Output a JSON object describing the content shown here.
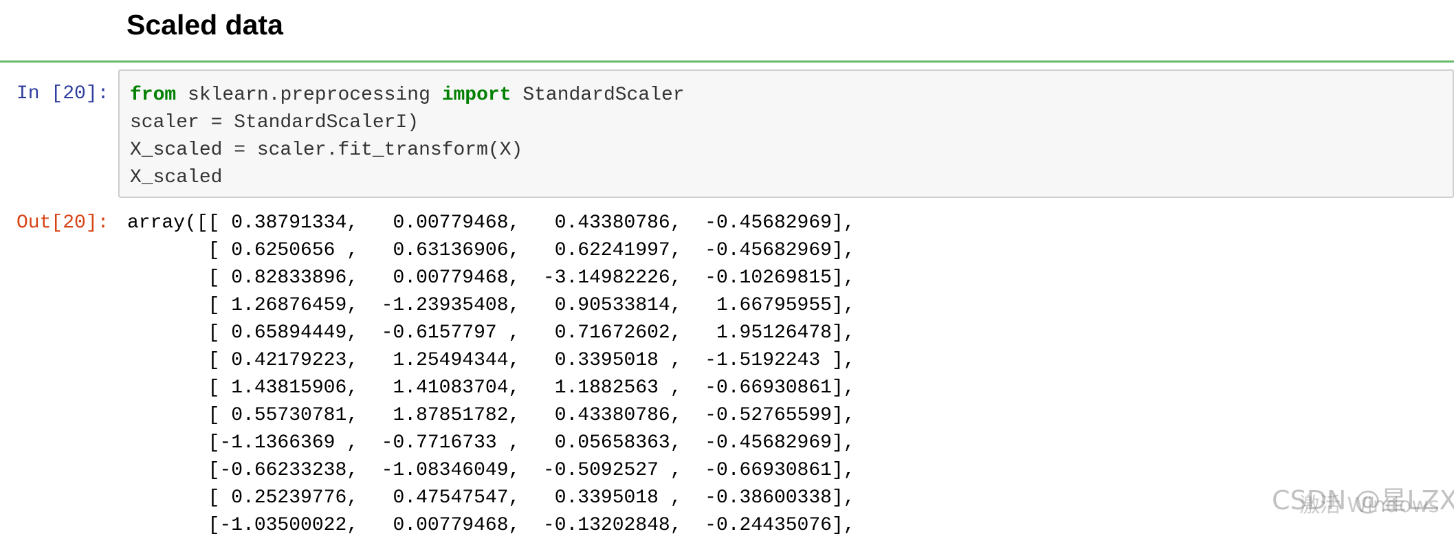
{
  "section": {
    "heading": "Scaled data"
  },
  "input_cell": {
    "prompt": "In [20]:",
    "lines": [
      {
        "kw1": "from",
        "mid": " sklearn.preprocessing ",
        "kw2": "import",
        "rest": " StandardScaler"
      },
      {
        "text_before": "scaler = StandardScaler",
        "cursor": "I",
        "text_after": ")"
      },
      {
        "text": "X_scaled = scaler.fit_transform(X)"
      },
      {
        "text": "X_scaled"
      }
    ]
  },
  "output_cell": {
    "prompt": "Out[20]:",
    "lines": [
      "array([[ 0.38791334,   0.00779468,   0.43380786,  -0.45682969],",
      "       [ 0.6250656 ,   0.63136906,   0.62241997,  -0.45682969],",
      "       [ 0.82833896,   0.00779468,  -3.14982226,  -0.10269815],",
      "       [ 1.26876459,  -1.23935408,   0.90533814,   1.66795955],",
      "       [ 0.65894449,  -0.6157797 ,   0.71672602,   1.95126478],",
      "       [ 0.42179223,   1.25494344,   0.3395018 ,  -1.5192243 ],",
      "       [ 1.43815906,   1.41083704,   1.1882563 ,  -0.66930861],",
      "       [ 0.55730781,   1.87851782,   0.43380786,  -0.52765599],",
      "       [-1.1366369 ,  -0.7716733 ,   0.05658363,  -0.45682969],",
      "       [-0.66233238,  -1.08346049,  -0.5092527 ,  -0.66930861],",
      "       [ 0.25239776,   0.47547547,   0.3395018 ,  -0.38600338],",
      "       [-1.03500022,   0.00779468,  -0.13202848,  -0.24435076],"
    ]
  },
  "overlays": {
    "activate_windows": "激活 Windows",
    "csdn_watermark": "CSDN @星LZX"
  },
  "colors": {
    "keyword": "#008000",
    "in_prompt": "#303f9f",
    "out_prompt": "#d84315",
    "cell_border": "#cfcfcf",
    "cell_background": "#f7f7f7",
    "divider": "#66bb6a"
  }
}
